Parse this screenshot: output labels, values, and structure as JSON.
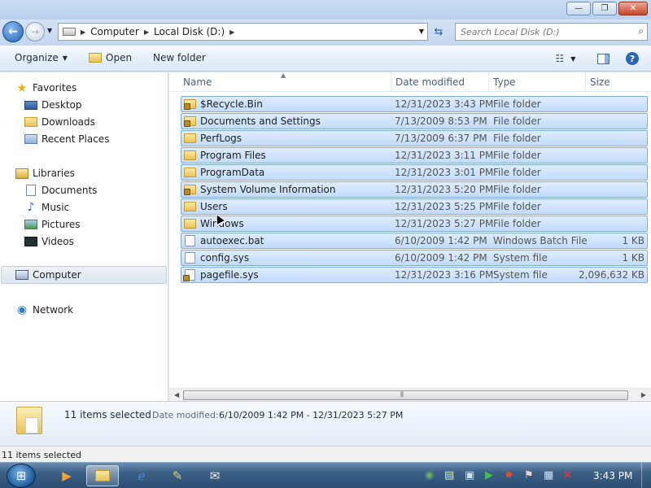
{
  "window": {
    "minimize": "—",
    "maximize": "❐",
    "close": "✕"
  },
  "nav": {
    "back": "←",
    "forward": "→",
    "breadcrumbs": [
      "Computer",
      "Local Disk (D:)"
    ],
    "search_placeholder": "Search Local Disk (D:)"
  },
  "toolbar": {
    "organize": "Organize",
    "open": "Open",
    "new_folder": "New folder"
  },
  "sidebar": {
    "favorites": {
      "label": "Favorites",
      "items": [
        "Desktop",
        "Downloads",
        "Recent Places"
      ]
    },
    "libraries": {
      "label": "Libraries",
      "items": [
        "Documents",
        "Music",
        "Pictures",
        "Videos"
      ]
    },
    "computer": "Computer",
    "network": "Network"
  },
  "columns": {
    "name": "Name",
    "date": "Date modified",
    "type": "Type",
    "size": "Size"
  },
  "files": [
    {
      "name": "$Recycle.Bin",
      "date": "12/31/2023 3:43 PM",
      "type": "File folder",
      "size": "",
      "kind": "folder",
      "locked": true
    },
    {
      "name": "Documents and Settings",
      "date": "7/13/2009 8:53 PM",
      "type": "File folder",
      "size": "",
      "kind": "folder",
      "locked": true
    },
    {
      "name": "PerfLogs",
      "date": "7/13/2009 6:37 PM",
      "type": "File folder",
      "size": "",
      "kind": "folder",
      "locked": false
    },
    {
      "name": "Program Files",
      "date": "12/31/2023 3:11 PM",
      "type": "File folder",
      "size": "",
      "kind": "folder",
      "locked": false
    },
    {
      "name": "ProgramData",
      "date": "12/31/2023 3:01 PM",
      "type": "File folder",
      "size": "",
      "kind": "folder",
      "locked": false
    },
    {
      "name": "System Volume Information",
      "date": "12/31/2023 5:20 PM",
      "type": "File folder",
      "size": "",
      "kind": "folder",
      "locked": true
    },
    {
      "name": "Users",
      "date": "12/31/2023 5:25 PM",
      "type": "File folder",
      "size": "",
      "kind": "folder",
      "locked": false
    },
    {
      "name": "Windows",
      "date": "12/31/2023 5:27 PM",
      "type": "File folder",
      "size": "",
      "kind": "folder",
      "locked": false
    },
    {
      "name": "autoexec.bat",
      "date": "6/10/2009 1:42 PM",
      "type": "Windows Batch File",
      "size": "1 KB",
      "kind": "file",
      "locked": false
    },
    {
      "name": "config.sys",
      "date": "6/10/2009 1:42 PM",
      "type": "System file",
      "size": "1 KB",
      "kind": "file",
      "locked": false
    },
    {
      "name": "pagefile.sys",
      "date": "12/31/2023 3:16 PM",
      "type": "System file",
      "size": "2,096,632 KB",
      "kind": "file",
      "locked": true
    }
  ],
  "details": {
    "count": "11 items selected",
    "date_label": "Date modified:",
    "date_value": "6/10/2009 1:42 PM - 12/31/2023 5:27 PM"
  },
  "status": "11 items selected",
  "taskbar": {
    "clock": "3:43 PM"
  },
  "colors": {
    "selection": "#c2dcfb",
    "selection_border": "#84acdd",
    "accent": "#1d5fb3"
  }
}
